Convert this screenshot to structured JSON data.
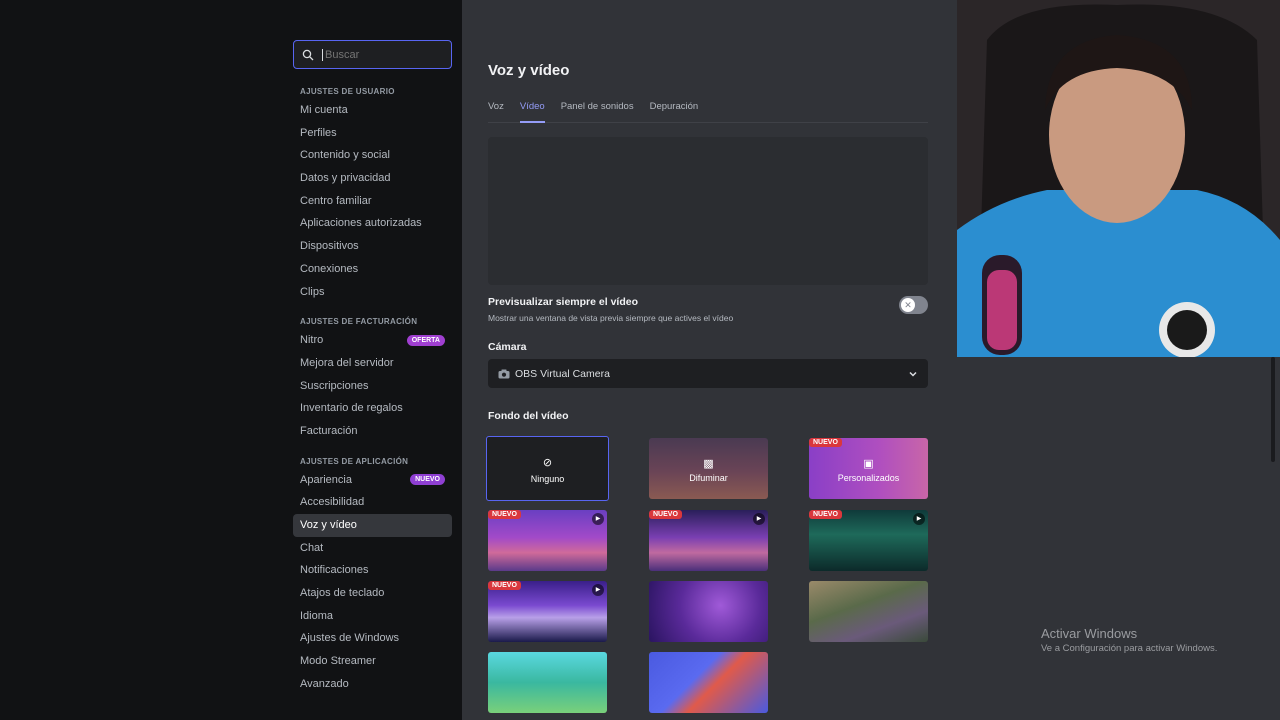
{
  "search": {
    "placeholder": "Buscar"
  },
  "sidebar": {
    "user_section": "AJUSTES DE USUARIO",
    "user_items": [
      "Mi cuenta",
      "Perfiles",
      "Contenido y social",
      "Datos y privacidad",
      "Centro familiar",
      "Aplicaciones autorizadas",
      "Dispositivos",
      "Conexiones",
      "Clips"
    ],
    "billing_section": "AJUSTES DE FACTURACIÓN",
    "billing_items": [
      "Nitro",
      "Mejora del servidor",
      "Suscripciones",
      "Inventario de regalos",
      "Facturación"
    ],
    "nitro_badge": "OFERTA",
    "app_section": "AJUSTES DE APLICACIÓN",
    "app_items": [
      "Apariencia",
      "Accesibilidad",
      "Voz y vídeo",
      "Chat",
      "Notificaciones",
      "Atajos de teclado",
      "Idioma",
      "Ajustes de Windows",
      "Modo Streamer",
      "Avanzado"
    ],
    "apariencia_badge": "NUEVO",
    "active_item": "Voz y vídeo"
  },
  "main": {
    "title": "Voz y vídeo",
    "tabs": [
      "Voz",
      "Vídeo",
      "Panel de sonidos",
      "Depuración"
    ],
    "active_tab": "Vídeo",
    "preview_toggle_label": "Previsualizar siempre el vídeo",
    "preview_toggle_desc": "Mostrar una ventana de vista previa siempre que actives el vídeo",
    "preview_toggle_on": false,
    "camera_label": "Cámara",
    "camera_value": "OBS Virtual Camera",
    "background_label": "Fondo del vídeo",
    "backgrounds": {
      "none_label": "Ninguno",
      "blur_label": "Difuminar",
      "custom_label": "Personalizados",
      "new_badge": "NUEVO"
    }
  },
  "watermark": {
    "line1": "Activar Windows",
    "line2": "Ve a Configuración para activar Windows."
  },
  "colors": {
    "accent": "#5865f2",
    "tab_active": "#949cf7",
    "new_badge": "#da373c",
    "offer_badge": "#a03fd1"
  }
}
